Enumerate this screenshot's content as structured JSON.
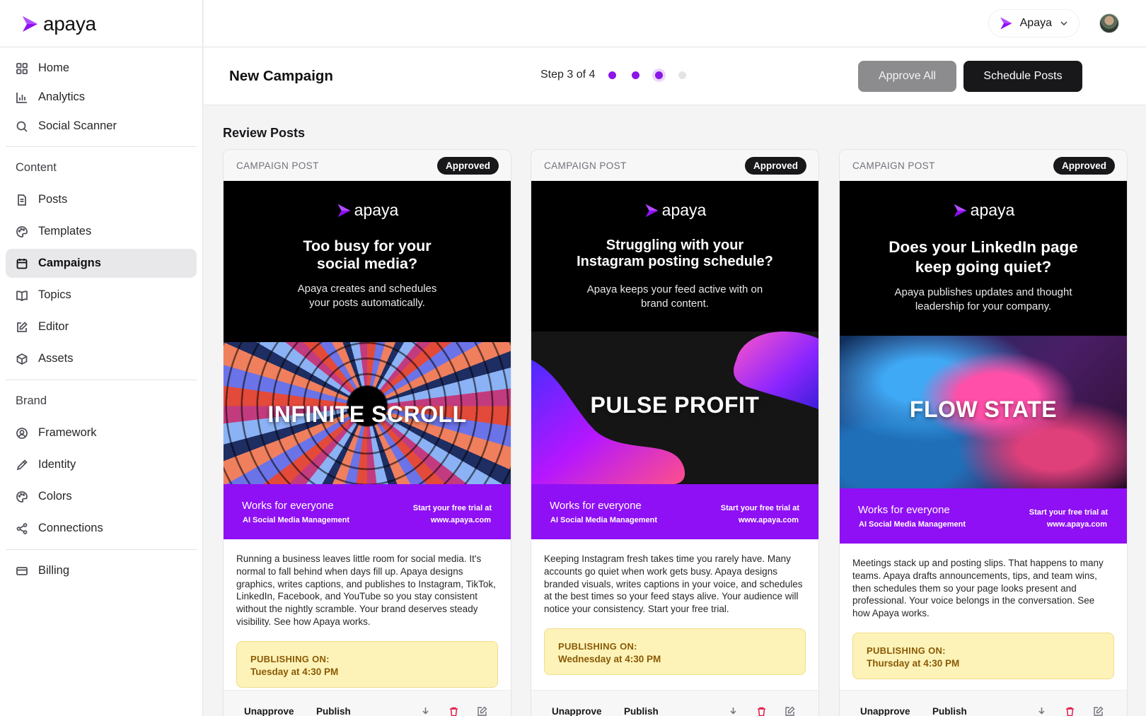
{
  "app": {
    "brand_name": "apaya",
    "accent_color": "#8f10f4"
  },
  "sidebar": {
    "items_main": [
      {
        "label": "Home",
        "icon": "grid-icon"
      },
      {
        "label": "Analytics",
        "icon": "bar-chart-icon"
      },
      {
        "label": "Social Scanner",
        "icon": "search-icon"
      }
    ],
    "content_section_label": "Content",
    "items_content": [
      {
        "label": "Posts",
        "icon": "document-icon"
      },
      {
        "label": "Templates",
        "icon": "palette-icon"
      },
      {
        "label": "Campaigns",
        "icon": "calendar-icon",
        "active": true
      },
      {
        "label": "Topics",
        "icon": "book-icon"
      },
      {
        "label": "Editor",
        "icon": "edit-icon"
      },
      {
        "label": "Assets",
        "icon": "box-icon"
      }
    ],
    "brand_section_label": "Brand",
    "items_brand": [
      {
        "label": "Framework",
        "icon": "user-circle-icon"
      },
      {
        "label": "Identity",
        "icon": "pen-icon"
      },
      {
        "label": "Colors",
        "icon": "palette-icon"
      },
      {
        "label": "Connections",
        "icon": "share-icon"
      }
    ],
    "items_bottom": [
      {
        "label": "Billing",
        "icon": "credit-card-icon"
      }
    ]
  },
  "topbar": {
    "account_name": "Apaya"
  },
  "header": {
    "title": "New Campaign",
    "step_text": "Step 3 of 4",
    "steps_total": 4,
    "steps_current": 3,
    "approve_all_label": "Approve All",
    "schedule_label": "Schedule Posts"
  },
  "review": {
    "title": "Review Posts"
  },
  "posts": [
    {
      "kicker": "CAMPAIGN POST",
      "status": "Approved",
      "creative": {
        "logo": "apaya",
        "headline_1": "Too busy for your",
        "headline_2": "social media?",
        "sub_1": "Apaya creates and schedules",
        "sub_2": "your posts automatically.",
        "image_title": "INFINITE SCROLL",
        "footer_left_1": "Works for everyone",
        "footer_left_2": "AI Social Media Management",
        "footer_right_1": "Start your free trial at",
        "footer_right_2": "www.apaya.com"
      },
      "body": "Running a business leaves little room for social media. It's normal to fall behind when days fill up. Apaya designs graphics, writes captions, and publishes to Instagram, TikTok, LinkedIn, Facebook, and YouTube so you stay consistent without the nightly scramble. Your brand deserves steady visibility. See how Apaya works.",
      "publish_label": "PUBLISHING ON:",
      "publish_when": "Tuesday at 4:30 PM",
      "unapprove_label": "Unapprove",
      "publish_action_label": "Publish"
    },
    {
      "kicker": "CAMPAIGN POST",
      "status": "Approved",
      "creative": {
        "logo": "apaya",
        "headline_1": "Struggling with your",
        "headline_2": "Instagram posting schedule?",
        "sub_1": "Apaya keeps your feed active with on",
        "sub_2": "brand content.",
        "image_title": "PULSE PROFIT",
        "footer_left_1": "Works for everyone",
        "footer_left_2": "AI Social Media Management",
        "footer_right_1": "Start your free trial at",
        "footer_right_2": "www.apaya.com"
      },
      "body": "Keeping Instagram fresh takes time you rarely have. Many accounts go quiet when work gets busy. Apaya designs branded visuals, writes captions in your voice, and schedules at the best times so your feed stays alive. Your audience will notice your consistency. Start your free trial.",
      "publish_label": "PUBLISHING ON:",
      "publish_when": "Wednesday at 4:30 PM",
      "unapprove_label": "Unapprove",
      "publish_action_label": "Publish"
    },
    {
      "kicker": "CAMPAIGN POST",
      "status": "Approved",
      "creative": {
        "logo": "apaya",
        "headline_1": "Does your LinkedIn page",
        "headline_2": "keep going quiet?",
        "sub_1": "Apaya publishes updates and thought",
        "sub_2": "leadership for your company.",
        "image_title": "FLOW STATE",
        "footer_left_1": "Works for everyone",
        "footer_left_2": "AI Social Media Management",
        "footer_right_1": "Start your free trial at",
        "footer_right_2": "www.apaya.com"
      },
      "body": "Meetings stack up and posting slips. That happens to many teams. Apaya drafts announcements, tips, and team wins, then schedules them so your page looks present and professional. Your voice belongs in the conversation. See how Apaya works.",
      "publish_label": "PUBLISHING ON:",
      "publish_when": "Thursday at 4:30 PM",
      "unapprove_label": "Unapprove",
      "publish_action_label": "Publish"
    }
  ]
}
